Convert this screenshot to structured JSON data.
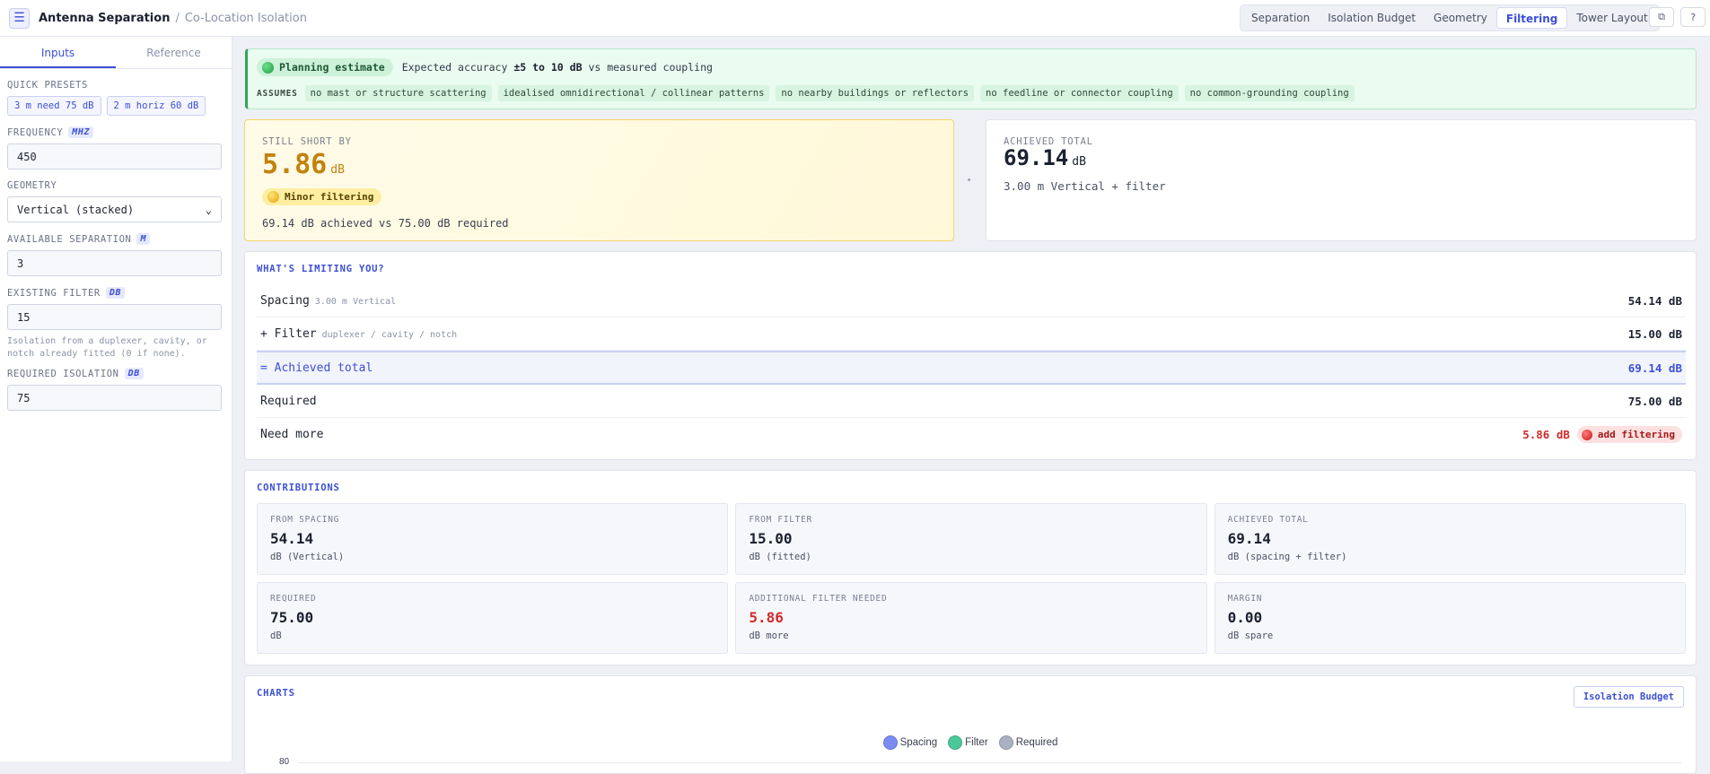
{
  "header": {
    "title": "Antenna Separation",
    "separator": "/",
    "subtitle": "Co-Location Isolation",
    "menu_icon": "☰",
    "tabs": [
      {
        "label": "Separation",
        "active": false
      },
      {
        "label": "Isolation Budget",
        "active": false
      },
      {
        "label": "Geometry",
        "active": false
      },
      {
        "label": "Filtering",
        "active": true
      },
      {
        "label": "Tower Layout",
        "active": false
      }
    ],
    "copy_icon": "⧉",
    "help_icon": "?"
  },
  "sidebar": {
    "tabs": [
      "Inputs",
      "Reference"
    ],
    "quick_presets_label": "QUICK PRESETS",
    "presets": [
      "3 m need 75 dB",
      "2 m horiz 60 dB"
    ],
    "frequency": {
      "label": "FREQUENCY",
      "unit": "MHZ",
      "value": "450"
    },
    "geometry": {
      "label": "GEOMETRY",
      "value": "Vertical (stacked)",
      "chevron": "⌄"
    },
    "separation": {
      "label": "AVAILABLE SEPARATION",
      "unit": "M",
      "value": "3"
    },
    "filter": {
      "label": "EXISTING FILTER",
      "unit": "DB",
      "value": "15",
      "hint": "Isolation from a duplexer, cavity, or notch already fitted (0 if none)."
    },
    "required": {
      "label": "REQUIRED ISOLATION",
      "unit": "DB",
      "value": "75"
    }
  },
  "planning": {
    "pill": "Planning estimate",
    "accuracy_prefix": "Expected accuracy",
    "accuracy_value": "±5 to 10 dB",
    "accuracy_suffix": "vs measured coupling",
    "assumes_label": "ASSUMES",
    "assumptions": [
      "no mast or structure scattering",
      "idealised omnidirectional / collinear patterns",
      "no nearby buildings or reflectors",
      "no feedline or connector coupling",
      "no common-grounding coupling"
    ]
  },
  "short": {
    "label": "STILL SHORT BY",
    "value": "5.86",
    "unit": "dB",
    "badge": "Minor filtering",
    "summary": "69.14 dB achieved vs 75.00 dB required"
  },
  "achieved": {
    "label": "ACHIEVED TOTAL",
    "value": "69.14",
    "unit": "dB",
    "sub": "3.00 m Vertical + filter"
  },
  "limiting": {
    "title": "WHAT'S LIMITING YOU?",
    "rows": [
      {
        "name": "Spacing",
        "meta": "3.00 m Vertical",
        "value": "54.14 dB"
      },
      {
        "name": "+ Filter",
        "meta": "duplexer / cavity / notch",
        "value": "15.00 dB"
      },
      {
        "name": "= Achieved total",
        "meta": "",
        "value": "69.14 dB"
      },
      {
        "name": "Required",
        "meta": "",
        "value": "75.00 dB"
      }
    ],
    "need": {
      "name": "Need more",
      "value": "5.86 dB",
      "badge": "add filtering"
    }
  },
  "contributions": {
    "title": "CONTRIBUTIONS",
    "cells": [
      {
        "label": "FROM SPACING",
        "value": "54.14",
        "unit": "dB (Vertical)"
      },
      {
        "label": "FROM FILTER",
        "value": "15.00",
        "unit": "dB (fitted)"
      },
      {
        "label": "ACHIEVED TOTAL",
        "value": "69.14",
        "unit": "dB (spacing + filter)"
      },
      {
        "label": "REQUIRED",
        "value": "75.00",
        "unit": "dB"
      },
      {
        "label": "ADDITIONAL FILTER NEEDED",
        "value": "5.86",
        "unit": "dB more"
      },
      {
        "label": "MARGIN",
        "value": "0.00",
        "unit": "dB spare"
      }
    ]
  },
  "charts": {
    "title": "CHARTS",
    "button": "Isolation Budget",
    "legend": [
      {
        "name": "Spacing",
        "color": "#7b8cf0"
      },
      {
        "name": "Filter",
        "color": "#4cc79a"
      },
      {
        "name": "Required",
        "color": "#a9b1c2"
      }
    ],
    "y_tick_top": "80"
  }
}
